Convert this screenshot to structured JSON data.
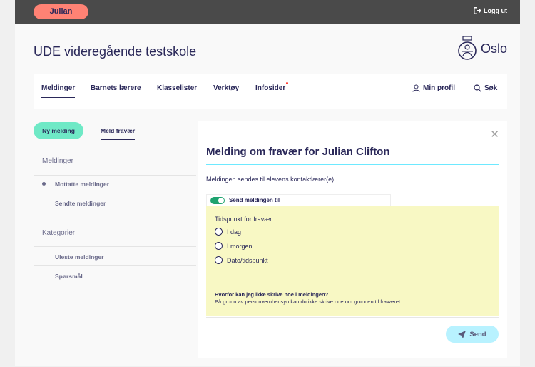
{
  "topbar": {
    "user_label": "Julian",
    "logout_label": "Logg ut"
  },
  "header": {
    "school_name": "UDE videregående testskole",
    "brand": "Oslo"
  },
  "nav": {
    "items": [
      {
        "label": "Meldinger"
      },
      {
        "label": "Barnets lærere"
      },
      {
        "label": "Klasselister"
      },
      {
        "label": "Verktøy"
      },
      {
        "label": "Infosider"
      }
    ],
    "profile_label": "Min profil",
    "search_label": "Søk"
  },
  "sidebar": {
    "new_message_label": "Ny melding",
    "absence_label": "Meld fravær",
    "section_messages": "Meldinger",
    "received_label": "Mottatte meldinger",
    "sent_label": "Sendte meldinger",
    "section_categories": "Kategorier",
    "unread_label": "Uleste meldinger",
    "questions_label": "Spørsmål"
  },
  "panel": {
    "title": "Melding om fravær for Julian Clifton",
    "subtitle": "Meldingen sendes til elevens kontaktlærer(e)",
    "toggle_label": "Send meldingen til",
    "time_label": "Tidspunkt for fravær:",
    "options": [
      "I dag",
      "I morgen",
      "Dato/tidspunkt"
    ],
    "why_question": "Hvorfor kan jeg ikke skrive noe i meldingen?",
    "why_answer": "På grunn av personvernhensyn kan du ikke skrive noe om grunnen til fraværet.",
    "send_label": "Send"
  },
  "colors": {
    "accent": "#6ee9ff",
    "pill": "#ff8274",
    "green": "#6fe9c6",
    "text": "#2a2859"
  }
}
